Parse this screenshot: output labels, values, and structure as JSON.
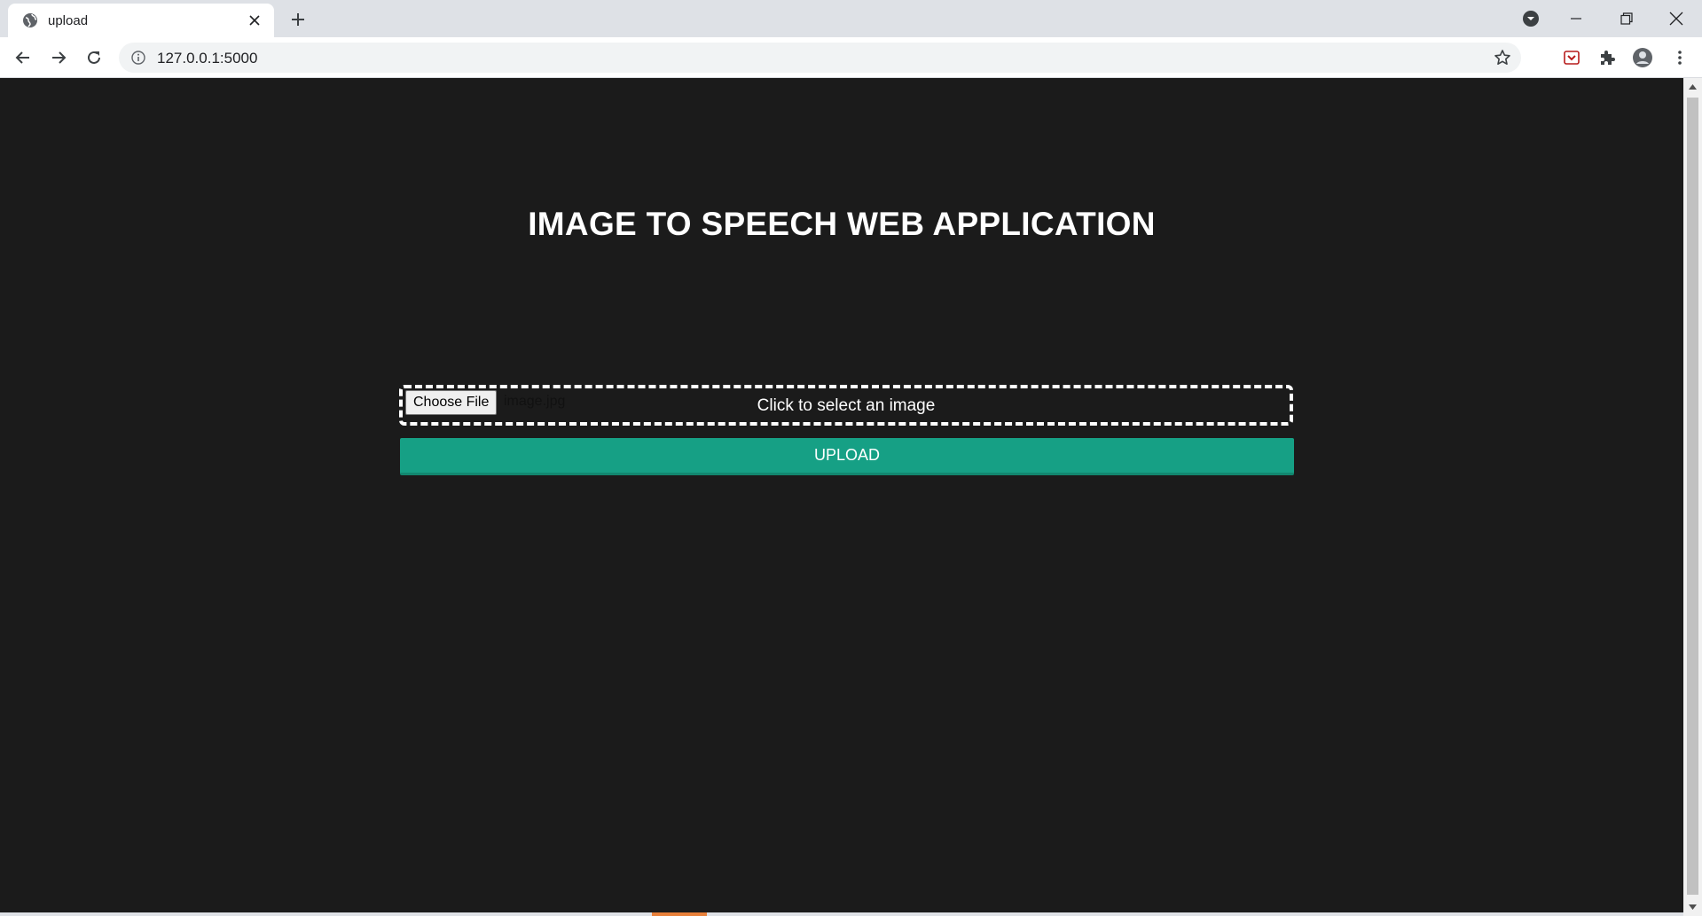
{
  "browser": {
    "tab": {
      "title": "upload",
      "favicon": "globe-icon",
      "close_icon": "close-icon"
    },
    "new_tab_icon": "plus-icon",
    "window_controls": [
      "dropdown-icon",
      "minimize-icon",
      "restore-icon",
      "close-icon"
    ],
    "toolbar": {
      "back_icon": "back-arrow-icon",
      "forward_icon": "forward-arrow-icon",
      "reload_icon": "reload-icon",
      "site_info_icon": "info-icon",
      "url": "127.0.0.1:5000",
      "bookmark_icon": "star-icon",
      "extensions": [
        "pocket-icon",
        "puzzle-icon",
        "profile-icon",
        "more-vert-icon"
      ]
    }
  },
  "page": {
    "background": "#1b1b1b",
    "title": "IMAGE TO SPEECH WEB APPLICATION",
    "file_input": {
      "button_label": "Choose File",
      "file_name": "image.jpg",
      "drop_label": "Click to select an image"
    },
    "upload_button": {
      "label": "UPLOAD",
      "color": "#16a085"
    }
  }
}
